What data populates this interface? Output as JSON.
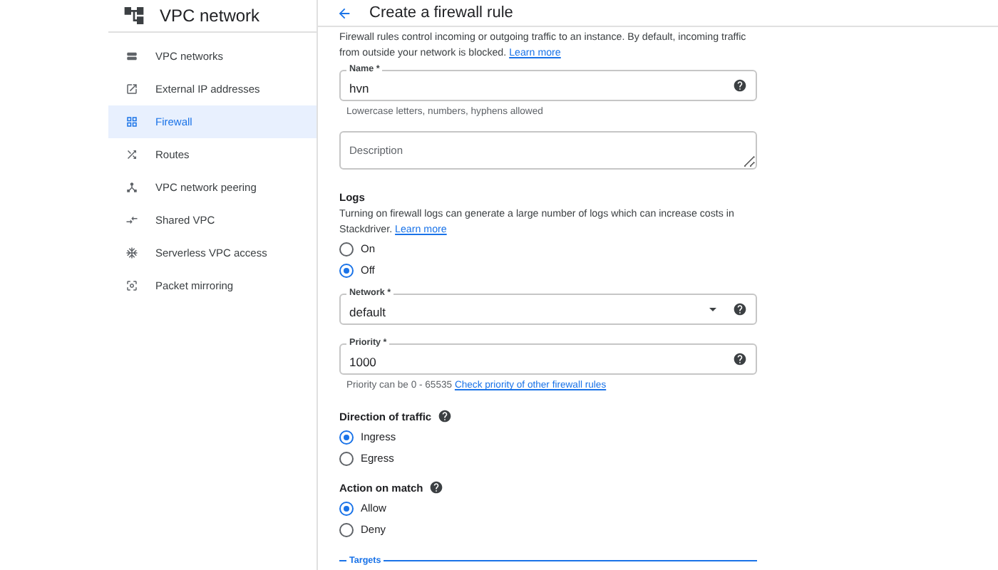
{
  "sidebar": {
    "title": "VPC network",
    "items": [
      {
        "label": "VPC networks",
        "selected": false
      },
      {
        "label": "External IP addresses",
        "selected": false
      },
      {
        "label": "Firewall",
        "selected": true
      },
      {
        "label": "Routes",
        "selected": false
      },
      {
        "label": "VPC network peering",
        "selected": false
      },
      {
        "label": "Shared VPC",
        "selected": false
      },
      {
        "label": "Serverless VPC access",
        "selected": false
      },
      {
        "label": "Packet mirroring",
        "selected": false
      }
    ]
  },
  "header": {
    "title": "Create a firewall rule"
  },
  "intro": {
    "text": "Firewall rules control incoming or outgoing traffic to an instance. By default, incoming traffic from outside your network is blocked.",
    "link": "Learn more"
  },
  "name_field": {
    "label": "Name *",
    "value": "hvn",
    "hint": "Lowercase letters, numbers, hyphens allowed"
  },
  "description_field": {
    "placeholder": "Description"
  },
  "logs": {
    "title": "Logs",
    "text": "Turning on firewall logs can generate a large number of logs which can increase costs in Stackdriver.",
    "link": "Learn more",
    "options": [
      {
        "label": "On",
        "selected": false
      },
      {
        "label": "Off",
        "selected": true
      }
    ]
  },
  "network_field": {
    "label": "Network *",
    "value": "default"
  },
  "priority_field": {
    "label": "Priority *",
    "value": "1000",
    "hint": "Priority can be 0 - 65535",
    "hint_link": "Check priority of other firewall rules"
  },
  "direction": {
    "title": "Direction of traffic",
    "options": [
      {
        "label": "Ingress",
        "selected": true
      },
      {
        "label": "Egress",
        "selected": false
      }
    ]
  },
  "action": {
    "title": "Action on match",
    "options": [
      {
        "label": "Allow",
        "selected": true
      },
      {
        "label": "Deny",
        "selected": false
      }
    ]
  },
  "targets_field": {
    "label": "Targets"
  }
}
